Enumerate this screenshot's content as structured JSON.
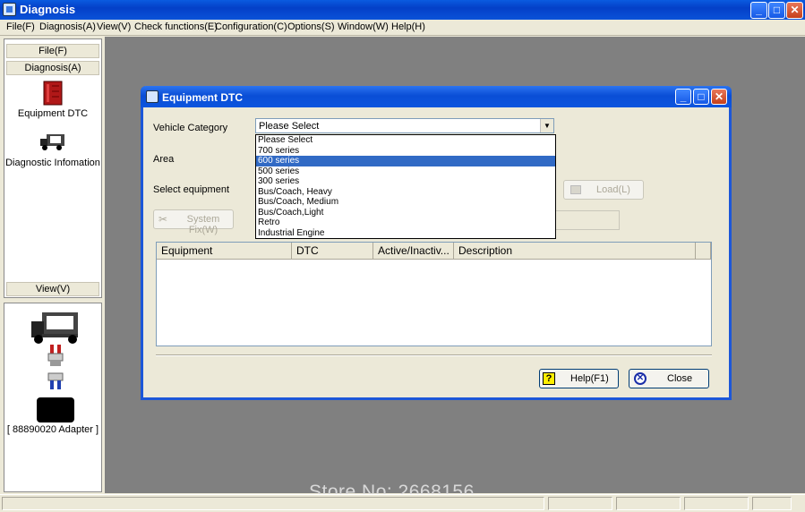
{
  "app": {
    "title": "Diagnosis"
  },
  "window_buttons": {
    "minimize": "_",
    "maximize": "□",
    "close": "✕"
  },
  "menu": [
    "File(F)",
    "Diagnosis(A)",
    "View(V)",
    "Check functions(E)",
    "Configuration(C)",
    "Options(S)",
    "Window(W)",
    "Help(H)"
  ],
  "left_nav": {
    "file_header": "File(F)",
    "diagnosis_header": "Diagnosis(A)",
    "items": [
      {
        "label": "Equipment DTC",
        "icon": "book-icon"
      },
      {
        "label": "Diagnostic Infomation",
        "icon": "truck-icon"
      }
    ],
    "view_header": "View(V)"
  },
  "adapter": {
    "label": "[ 88890020 Adapter ]"
  },
  "dialog": {
    "title": "Equipment DTC",
    "vehicle_category_label": "Vehicle Category",
    "vehicle_category_value": "Please Select",
    "area_label": "Area",
    "select_equipment_label": "Select equipment",
    "dropdown_options": [
      "Please Select",
      "700 series",
      "600 series",
      "500 series",
      "300 series",
      "Bus/Coach, Heavy",
      "Bus/Coach, Medium",
      "Bus/Coach,Light",
      "Retro",
      "Industrial Engine"
    ],
    "dropdown_selected": "600 series",
    "load_button": "Load(L)",
    "system_fix_button": "System Fix(W)",
    "columns": [
      "Equipment",
      "DTC",
      "Active/Inactiv...",
      "Description"
    ],
    "help_button": "Help(F1)",
    "close_button": "Close"
  },
  "watermark": "Store No: 2668156",
  "colors": {
    "titlebar": "#0a4ed6",
    "selection": "#316ac5",
    "mdi_background": "#808080"
  }
}
